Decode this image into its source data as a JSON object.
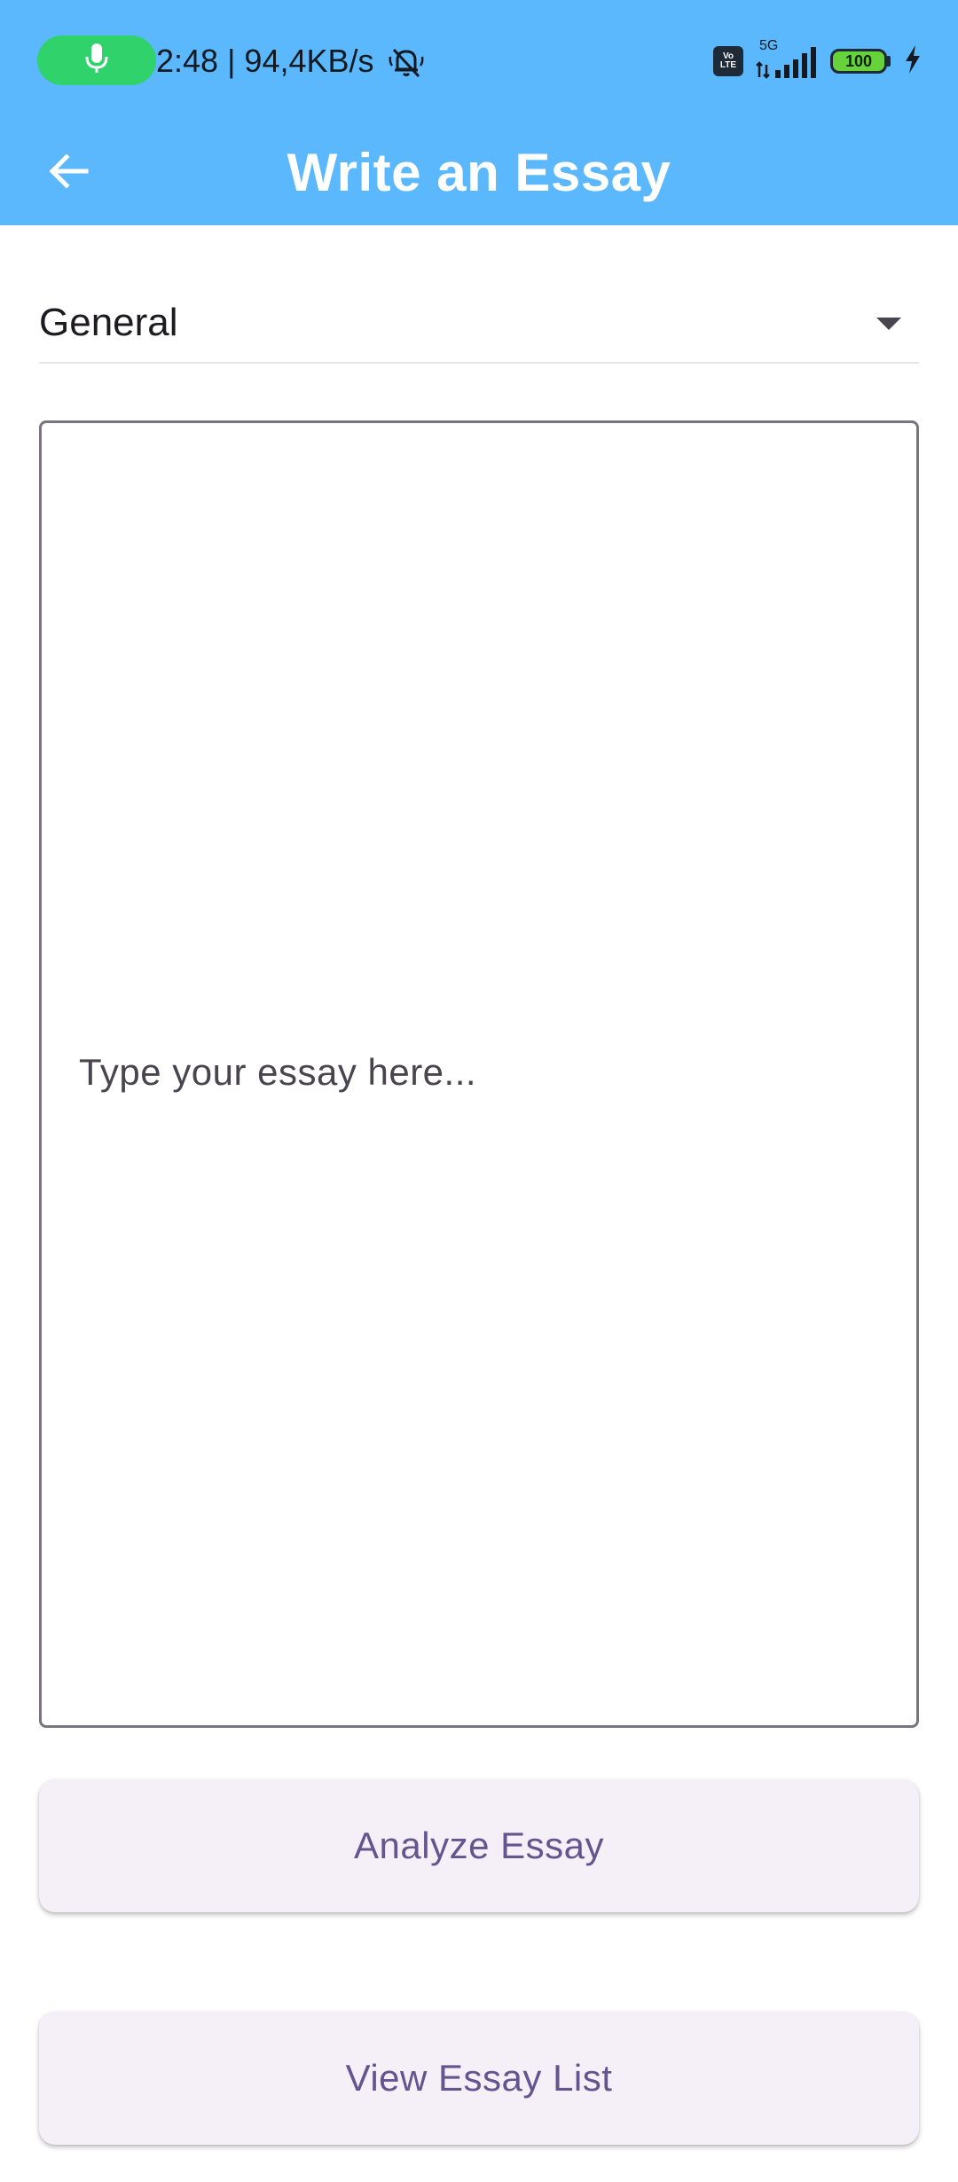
{
  "status_bar": {
    "time_and_speed": "2:48 | 94,4KB/s",
    "mic_icon": "microphone-icon",
    "bell_icon": "bell-muted-icon",
    "volte_label_top": "Vo",
    "volte_label_bottom": "LTE",
    "network_type": "5G",
    "battery_level": "100",
    "charging_icon": "lightning-icon",
    "mic_pill_color": "#2FD26B"
  },
  "app_bar": {
    "title": "Write an Essay",
    "back_icon": "arrow-left-icon",
    "background_color": "#5BB8FC"
  },
  "form": {
    "category_selected": "General",
    "category_arrow_icon": "dropdown-triangle-icon",
    "essay_placeholder": "Type your essay here...",
    "essay_value": ""
  },
  "actions": {
    "analyze_label": "Analyze Essay",
    "view_list_label": "View Essay List",
    "button_text_color": "#65558F",
    "button_bg_color": "#F5EFF7"
  }
}
